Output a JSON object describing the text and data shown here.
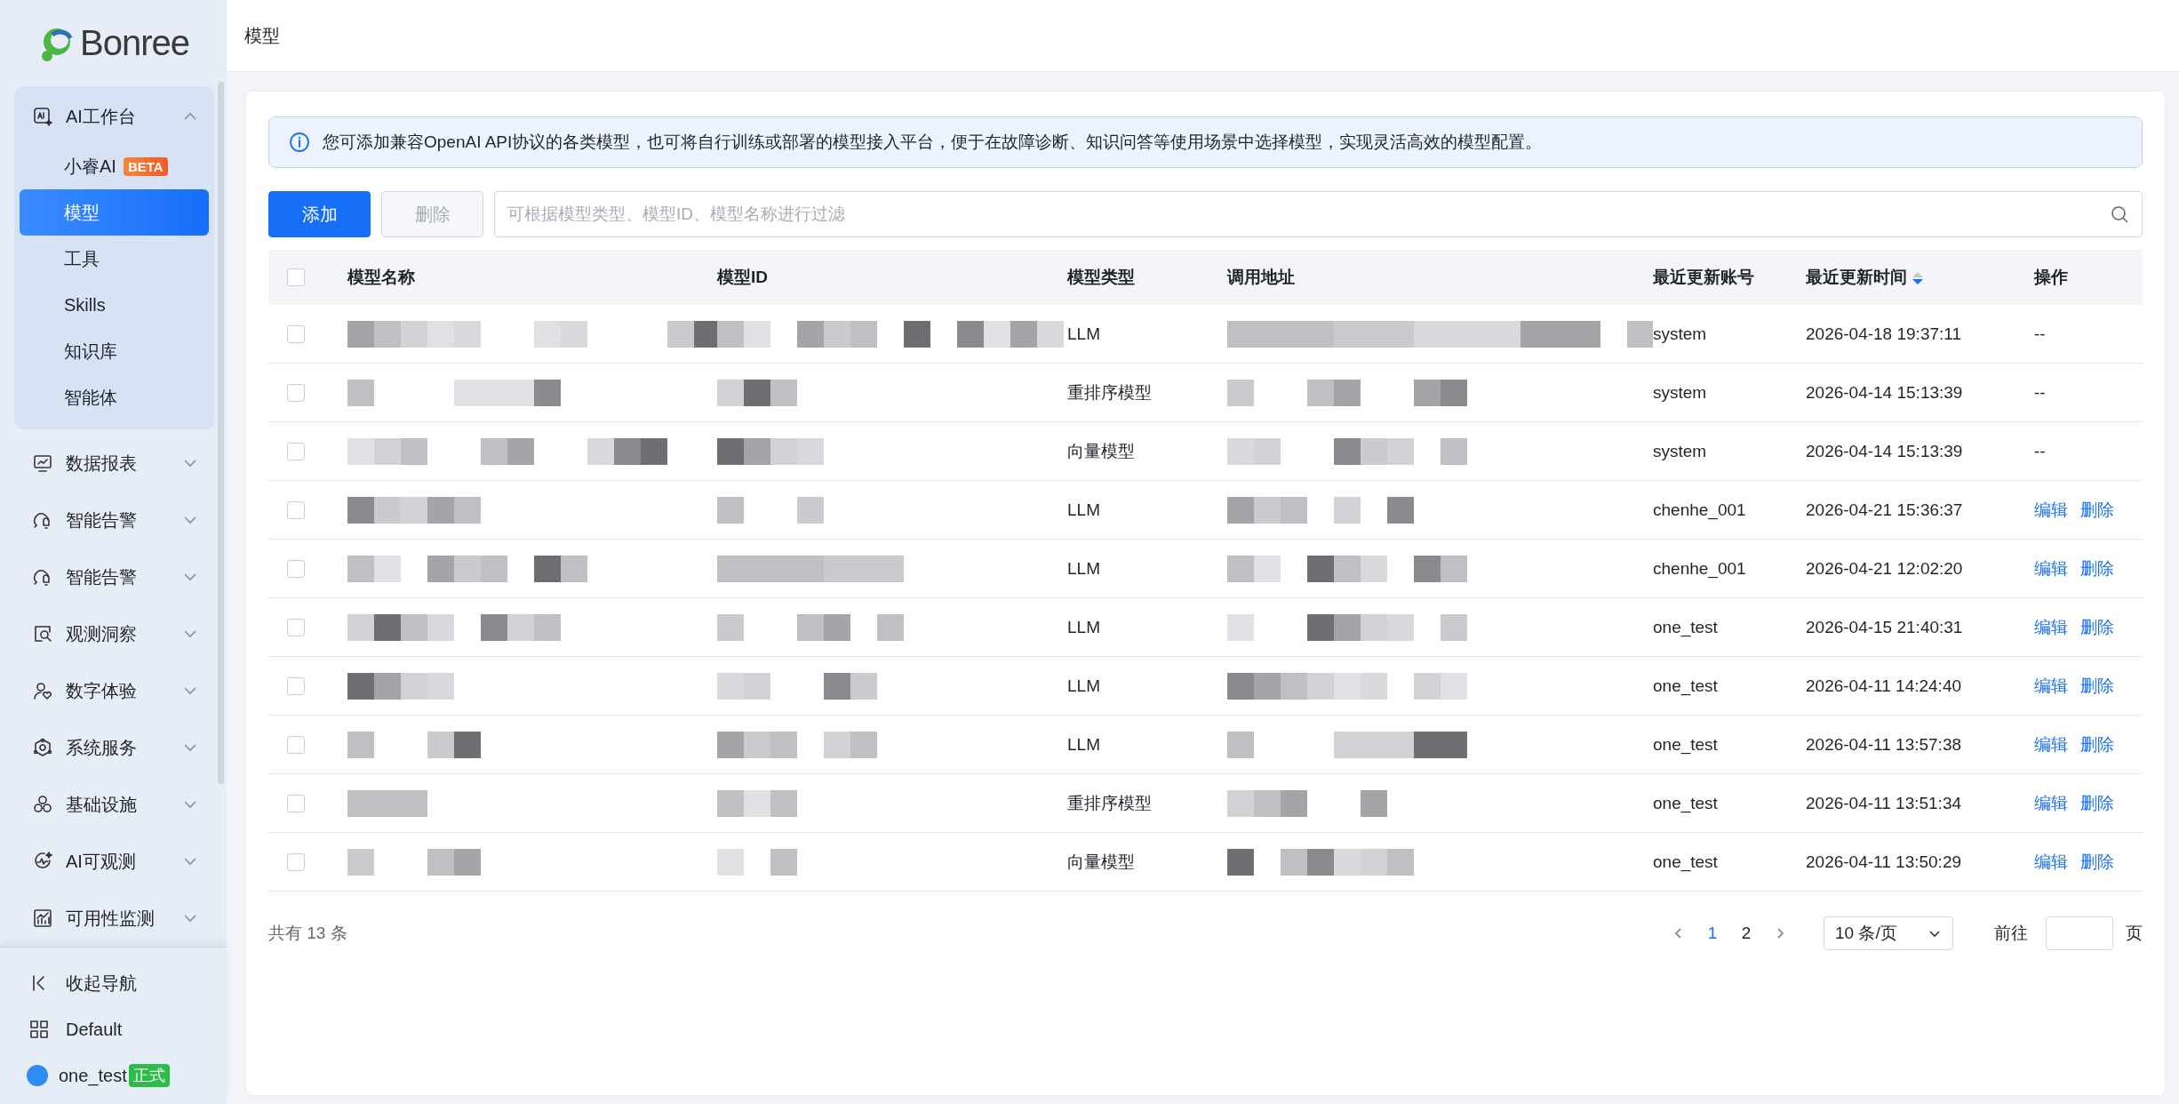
{
  "logo": {
    "text": "Bonree"
  },
  "sidebar": {
    "groups": [
      {
        "label": "AI工作台",
        "expanded": true,
        "children": [
          {
            "label": "小睿AI",
            "badge": "BETA",
            "selected": false
          },
          {
            "label": "模型",
            "selected": true
          },
          {
            "label": "工具",
            "selected": false
          },
          {
            "label": "Skills",
            "selected": false
          },
          {
            "label": "知识库",
            "selected": false
          },
          {
            "label": "智能体",
            "selected": false
          }
        ]
      },
      {
        "label": "数据报表",
        "expanded": false
      },
      {
        "label": "智能告警",
        "expanded": false
      },
      {
        "label": "智能告警",
        "expanded": false
      },
      {
        "label": "观测洞察",
        "expanded": false
      },
      {
        "label": "数字体验",
        "expanded": false
      },
      {
        "label": "系统服务",
        "expanded": false
      },
      {
        "label": "基础设施",
        "expanded": false
      },
      {
        "label": "AI可观测",
        "expanded": false
      },
      {
        "label": "可用性监测",
        "expanded": false
      }
    ],
    "footer_items": [
      {
        "label": "收起导航"
      },
      {
        "label": "Default"
      }
    ],
    "user": {
      "name": "one_test",
      "badge": "正式"
    }
  },
  "header": {
    "title": "模型"
  },
  "notice": "您可添加兼容OpenAI API协议的各类模型，也可将自行训练或部署的模型接入平台，便于在故障诊断、知识问答等使用场景中选择模型，实现灵活高效的模型配置。",
  "toolbar": {
    "add": "添加",
    "delete": {
      "label": "删除",
      "disabled": true
    },
    "search": {
      "placeholder": "可根据模型类型、模型ID、模型名称进行过滤"
    }
  },
  "table": {
    "select_all": {
      "checked": false
    },
    "columns": [
      {
        "label": "模型名称"
      },
      {
        "label": "模型ID"
      },
      {
        "label": "模型类型"
      },
      {
        "label": "调用地址"
      },
      {
        "label": "最近更新账号"
      },
      {
        "label": "最近更新时间",
        "sorted_descending": true
      },
      {
        "label": "操作"
      }
    ],
    "rows": [
      {
        "checked": false,
        "type": "LLM",
        "account": "system",
        "updated": "2026-04-18 19:37:11",
        "actions": [
          {
            "kind": "text",
            "label": "--"
          }
        ]
      },
      {
        "checked": false,
        "type": "重排序模型",
        "account": "system",
        "updated": "2026-04-14 15:13:39",
        "actions": [
          {
            "kind": "text",
            "label": "--"
          }
        ]
      },
      {
        "checked": false,
        "type": "向量模型",
        "account": "system",
        "updated": "2026-04-14 15:13:39",
        "actions": [
          {
            "kind": "text",
            "label": "--"
          }
        ]
      },
      {
        "checked": false,
        "type": "LLM",
        "account": "chenhe_001",
        "updated": "2026-04-21 15:36:37",
        "actions": [
          {
            "kind": "link",
            "label": "编辑"
          },
          {
            "kind": "link",
            "label": "删除"
          }
        ]
      },
      {
        "checked": false,
        "type": "LLM",
        "account": "chenhe_001",
        "updated": "2026-04-21 12:02:20",
        "actions": [
          {
            "kind": "link",
            "label": "编辑"
          },
          {
            "kind": "link",
            "label": "删除"
          }
        ]
      },
      {
        "checked": false,
        "type": "LLM",
        "account": "one_test",
        "updated": "2026-04-15 21:40:31",
        "actions": [
          {
            "kind": "link",
            "label": "编辑"
          },
          {
            "kind": "link",
            "label": "删除"
          }
        ]
      },
      {
        "checked": false,
        "type": "LLM",
        "account": "one_test",
        "updated": "2026-04-11 14:24:40",
        "actions": [
          {
            "kind": "link",
            "label": "编辑"
          },
          {
            "kind": "link",
            "label": "删除"
          }
        ]
      },
      {
        "checked": false,
        "type": "LLM",
        "account": "one_test",
        "updated": "2026-04-11 13:57:38",
        "actions": [
          {
            "kind": "link",
            "label": "编辑"
          },
          {
            "kind": "link",
            "label": "删除"
          }
        ]
      },
      {
        "checked": false,
        "type": "重排序模型",
        "account": "one_test",
        "updated": "2026-04-11 13:51:34",
        "actions": [
          {
            "kind": "link",
            "label": "编辑"
          },
          {
            "kind": "link",
            "label": "删除"
          }
        ]
      },
      {
        "checked": false,
        "type": "向量模型",
        "account": "one_test",
        "updated": "2026-04-11 13:50:29",
        "actions": [
          {
            "kind": "link",
            "label": "编辑"
          },
          {
            "kind": "link",
            "label": "删除"
          }
        ]
      }
    ]
  },
  "pagination": {
    "total": "共有 13 条",
    "pages": [
      {
        "label": "1",
        "selected": true
      },
      {
        "label": "2",
        "selected": false
      }
    ],
    "page_size": "10 条/页",
    "goto_label": "前往",
    "goto_suffix": "页"
  }
}
